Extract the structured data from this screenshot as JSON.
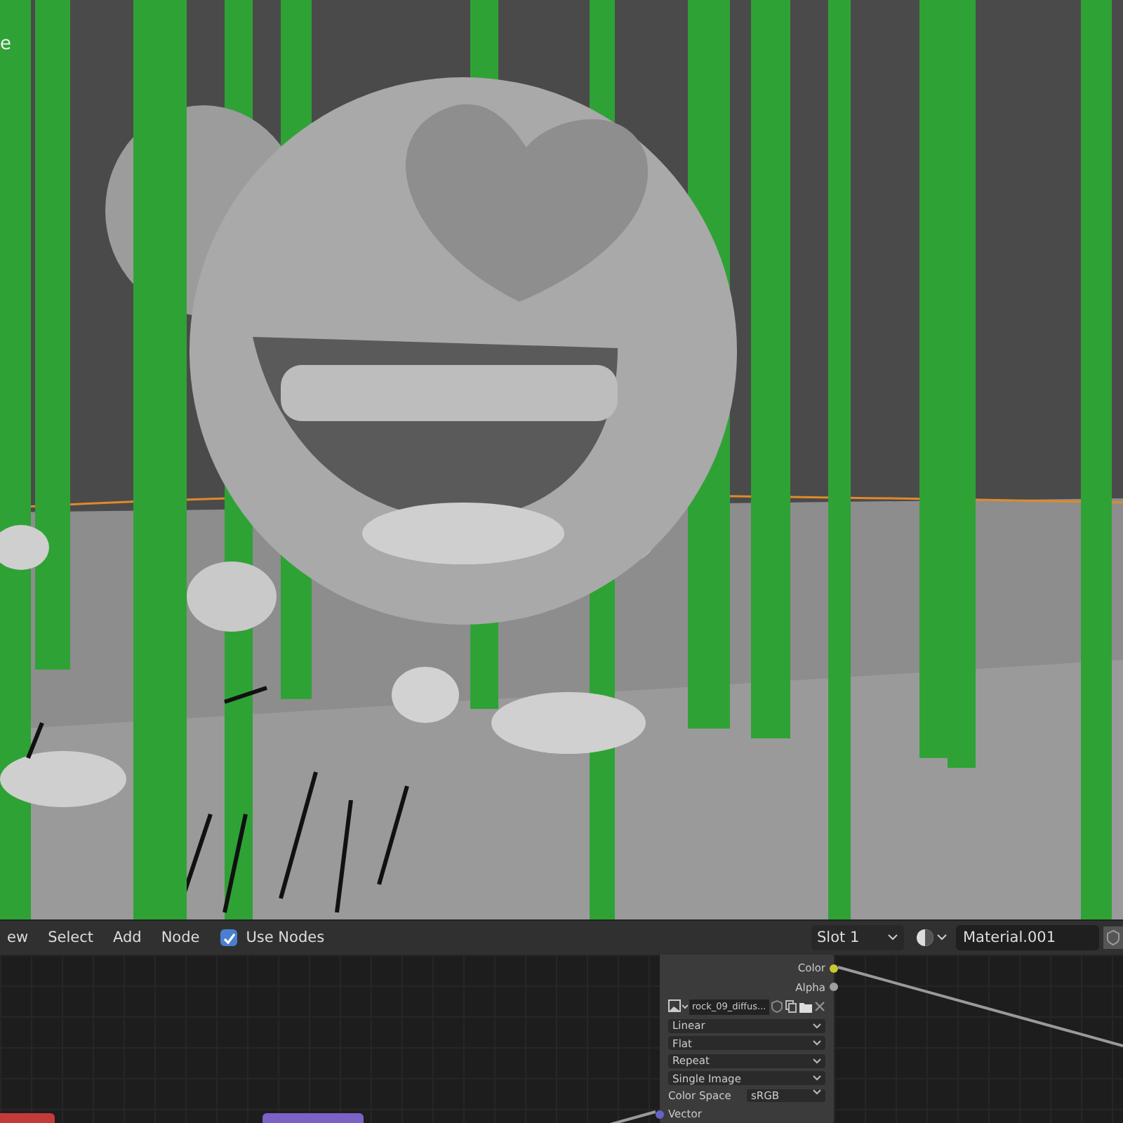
{
  "viewport": {
    "corner_label": "e"
  },
  "header": {
    "menus": [
      "ew",
      "Select",
      "Add",
      "Node"
    ],
    "use_nodes": {
      "label": "Use Nodes",
      "checked": true
    },
    "slot": "Slot 1",
    "material": "Material.001"
  },
  "node": {
    "outputs": [
      {
        "label": "Color",
        "color": "#c8c832"
      },
      {
        "label": "Alpha",
        "color": "#a0a0a0"
      }
    ],
    "image_name": "rock_09_diffus...",
    "dropdowns": [
      "Linear",
      "Flat",
      "Repeat",
      "Single Image"
    ],
    "color_space": {
      "label": "Color Space",
      "value": "sRGB"
    },
    "inputs": [
      {
        "label": "Vector",
        "color": "#6464c8"
      }
    ]
  },
  "partial_nodes": [
    {
      "color": "#c23a3a"
    },
    {
      "color": "#7b62c7"
    }
  ]
}
